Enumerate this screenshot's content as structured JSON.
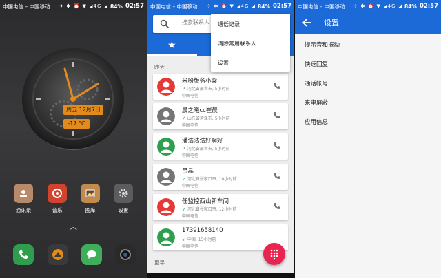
{
  "status_bar": {
    "carrier": "中国电信 – 中国移动",
    "icons": "✈ ✱ ⏰ ▼ ◢4G ◢",
    "battery": "84%",
    "time": "02:57"
  },
  "home": {
    "clock": {
      "weekday": "周五",
      "date": "12月7日",
      "temperature": "-17 °C"
    },
    "apps": [
      {
        "label": "通讯录",
        "icon": "contacts-icon"
      },
      {
        "label": "音乐",
        "icon": "music-icon"
      },
      {
        "label": "图库",
        "icon": "gallery-icon"
      },
      {
        "label": "设置",
        "icon": "settings-icon"
      }
    ],
    "dock": [
      "phone-icon",
      "camera-roll-icon",
      "messages-icon",
      "camera-icon"
    ]
  },
  "contacts": {
    "search_placeholder": "搜索联系人",
    "section_recent": "昨天",
    "section_earlier": "更早",
    "menu": [
      "通话记录",
      "清除常用联系人",
      "设置"
    ],
    "calls": [
      {
        "name": "米粉版务小梁",
        "detail": "河北省邢台市, 5小时前",
        "carrier": "中国电信",
        "color": "#e53935",
        "direction": "outgoing"
      },
      {
        "name": "晨之曦cc崔晨",
        "detail": "山东省菏泽市, 5小时前",
        "carrier": "中国电信",
        "color": "#757575",
        "direction": "outgoing"
      },
      {
        "name": "潘浩浩浩好啊好",
        "detail": "河北省邢台市, 5小时前",
        "carrier": "中国电信",
        "color": "#2e9e4f",
        "direction": "outgoing"
      },
      {
        "name": "吕晶",
        "detail": "河北省张家口市, 10小时前",
        "carrier": "中国电信",
        "color": "#757575",
        "direction": "incoming"
      },
      {
        "name": "任监控西山新车间",
        "detail": "河北省张家口市, 12小时前",
        "carrier": "中国电信",
        "color": "#e53935",
        "direction": "incoming"
      },
      {
        "name": "17391658140",
        "detail": "中国, 15小时前",
        "carrier": "中国电信",
        "color": "#2e9e4f",
        "direction": "missed"
      }
    ]
  },
  "settings": {
    "title": "设置",
    "items": [
      "提示音和振动",
      "快速回复",
      "通话帐号",
      "来电屏蔽",
      "应用信息"
    ]
  },
  "colors": {
    "primary": "#1b6ad8",
    "fab": "#e8244f",
    "accent_orange": "#e38a1c"
  }
}
